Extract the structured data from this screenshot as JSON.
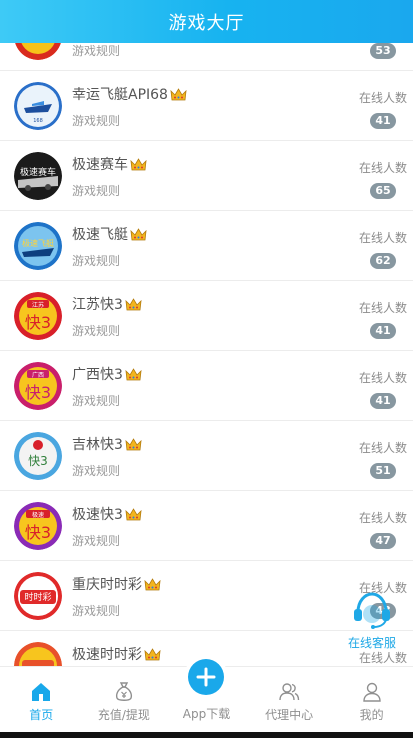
{
  "header": {
    "title": "游戏大厅"
  },
  "games": [
    {
      "name": "",
      "rules": "游戏规则",
      "online_label": "",
      "count": "53",
      "logo": "logo-lucky-10"
    },
    {
      "name": "幸运飞艇API68",
      "rules": "游戏规则",
      "online_label": "在线人数",
      "count": "41",
      "logo": "logo-lucky-boat"
    },
    {
      "name": "极速赛车",
      "rules": "游戏规则",
      "online_label": "在线人数",
      "count": "65",
      "logo": "logo-speed-racing"
    },
    {
      "name": "极速飞艇",
      "rules": "游戏规则",
      "online_label": "在线人数",
      "count": "62",
      "logo": "logo-speed-boat"
    },
    {
      "name": "江苏快3",
      "rules": "游戏规则",
      "online_label": "在线人数",
      "count": "41",
      "logo": "logo-jiangsu-k3"
    },
    {
      "name": "广西快3",
      "rules": "游戏规则",
      "online_label": "在线人数",
      "count": "41",
      "logo": "logo-guangxi-k3"
    },
    {
      "name": "吉林快3",
      "rules": "游戏规则",
      "online_label": "在线人数",
      "count": "51",
      "logo": "logo-jilin-k3"
    },
    {
      "name": "极速快3",
      "rules": "游戏规则",
      "online_label": "在线人数",
      "count": "47",
      "logo": "logo-speed-k3"
    },
    {
      "name": "重庆时时彩",
      "rules": "游戏规则",
      "online_label": "在线人数",
      "count": "48",
      "logo": "logo-chongqing-ssc"
    },
    {
      "name": "极速时时彩",
      "rules": "",
      "online_label": "在线人数",
      "count": "",
      "logo": "logo-speed-ssc"
    }
  ],
  "service": {
    "label": "在线客服",
    "icon": "headset-icon"
  },
  "tabbar": {
    "items": [
      {
        "label": "首页",
        "icon": "home-icon"
      },
      {
        "label": "充值/提现",
        "icon": "money-bag-icon"
      },
      {
        "label": "App下载",
        "icon": "plus-icon"
      },
      {
        "label": "代理中心",
        "icon": "users-icon"
      },
      {
        "label": "我的",
        "icon": "user-icon"
      }
    ]
  },
  "colors": {
    "header_start": "#3ecaf6",
    "header_end": "#1aa8ee",
    "accent": "#18a8ea",
    "badge": "#8797a0",
    "crown": "#f3b51f"
  }
}
